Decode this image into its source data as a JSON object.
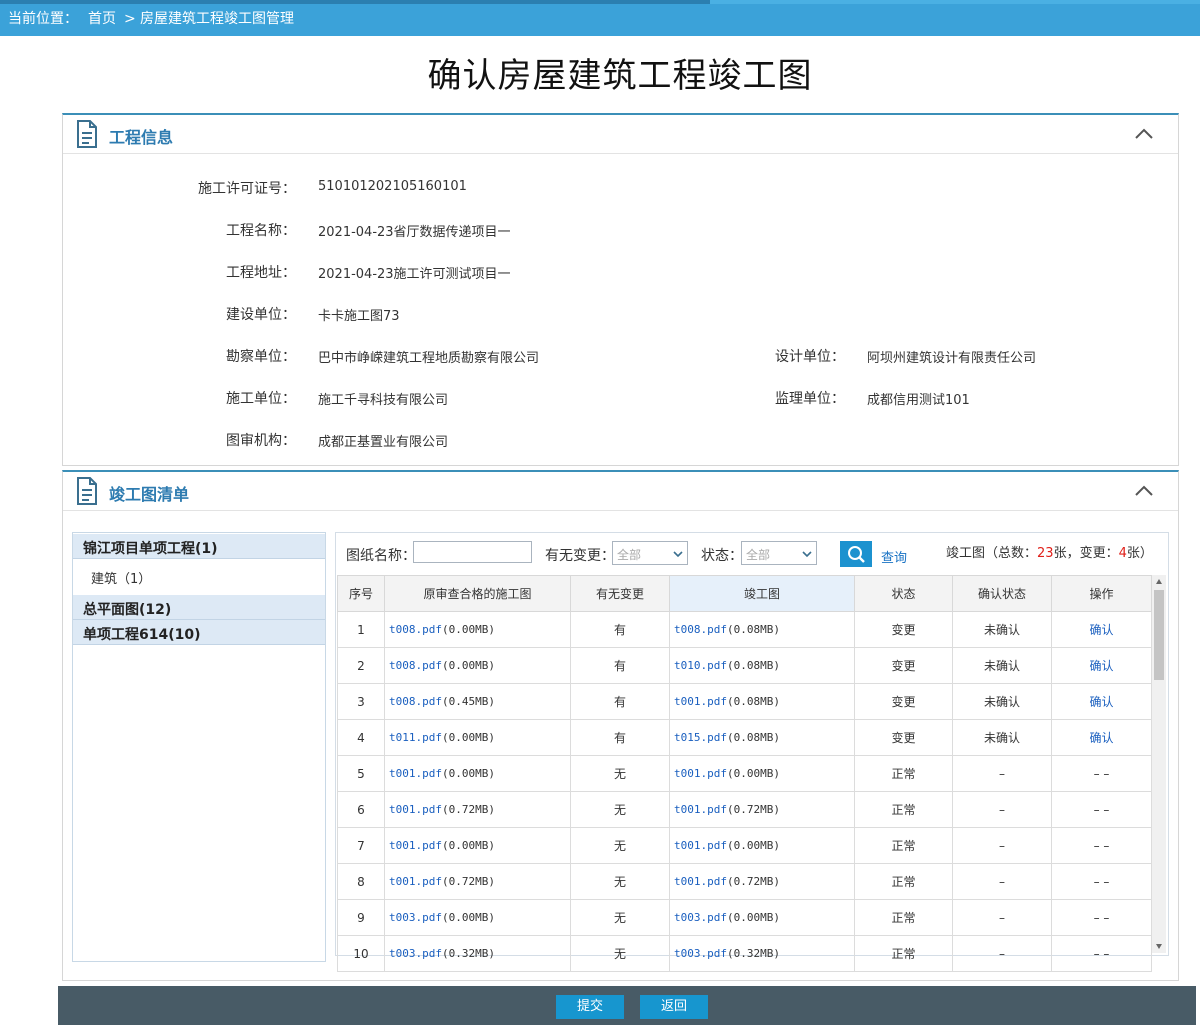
{
  "breadcrumb": {
    "label": "当前位置：",
    "home": "首页",
    "separator": ">",
    "current": "房屋建筑工程竣工图管理"
  },
  "page_title": "确认房屋建筑工程竣工图",
  "project_panel": {
    "title": "工程信息",
    "fields": {
      "permit_label": "施工许可证号：",
      "permit_value": "510101202105160101",
      "name_label": "工程名称：",
      "name_value": "2021-04-23省厅数据传递项目一",
      "address_label": "工程地址：",
      "address_value": "2021-04-23施工许可测试项目一",
      "builder_label": "建设单位：",
      "builder_value": "卡卡施工图73",
      "survey_label": "勘察单位：",
      "survey_value": "巴中市峥嵘建筑工程地质勘察有限公司",
      "design_label": "设计单位：",
      "design_value": "阿坝州建筑设计有限责任公司",
      "construction_label": "施工单位：",
      "construction_value": "施工千寻科技有限公司",
      "supervision_label": "监理单位：",
      "supervision_value": "成都信用测试101",
      "review_label": "图审机构：",
      "review_value": "成都正基置业有限公司"
    }
  },
  "drawings_panel": {
    "title": "竣工图清单",
    "tree": {
      "group1": "锦江项目单项工程(1)",
      "group1_child": "建筑（1）",
      "group2": "总平面图(12)",
      "group3": "单项工程614(10)"
    },
    "filters": {
      "name_label": "图纸名称：",
      "name_value": "",
      "change_label": "有无变更：",
      "change_value": "全部",
      "status_label": "状态：",
      "status_value": "全部",
      "search_label": "查询"
    },
    "stats": {
      "prefix": "竣工图（总数：",
      "total": "23",
      "mid": "张，变更：",
      "changed": "4",
      "suffix": "张）"
    },
    "table": {
      "headers": [
        "序号",
        "原审查合格的施工图",
        "有无变更",
        "竣工图",
        "状态",
        "确认状态",
        "操作"
      ],
      "rows": [
        {
          "no": "1",
          "orig": "t008.pdf",
          "orig_size": "(0.00MB)",
          "change": "有",
          "final": "t008.pdf",
          "final_size": "(0.08MB)",
          "status": "变更",
          "confirm": "未确认",
          "op": "确认"
        },
        {
          "no": "2",
          "orig": "t008.pdf",
          "orig_size": "(0.00MB)",
          "change": "有",
          "final": "t010.pdf",
          "final_size": "(0.08MB)",
          "status": "变更",
          "confirm": "未确认",
          "op": "确认"
        },
        {
          "no": "3",
          "orig": "t008.pdf",
          "orig_size": "(0.45MB)",
          "change": "有",
          "final": "t001.pdf",
          "final_size": "(0.08MB)",
          "status": "变更",
          "confirm": "未确认",
          "op": "确认"
        },
        {
          "no": "4",
          "orig": "t011.pdf",
          "orig_size": "(0.00MB)",
          "change": "有",
          "final": "t015.pdf",
          "final_size": "(0.08MB)",
          "status": "变更",
          "confirm": "未确认",
          "op": "确认"
        },
        {
          "no": "5",
          "orig": "t001.pdf",
          "orig_size": "(0.00MB)",
          "change": "无",
          "final": "t001.pdf",
          "final_size": "(0.00MB)",
          "status": "正常",
          "confirm": "–",
          "op": "– –"
        },
        {
          "no": "6",
          "orig": "t001.pdf",
          "orig_size": "(0.72MB)",
          "change": "无",
          "final": "t001.pdf",
          "final_size": "(0.72MB)",
          "status": "正常",
          "confirm": "–",
          "op": "– –"
        },
        {
          "no": "7",
          "orig": "t001.pdf",
          "orig_size": "(0.00MB)",
          "change": "无",
          "final": "t001.pdf",
          "final_size": "(0.00MB)",
          "status": "正常",
          "confirm": "–",
          "op": "– –"
        },
        {
          "no": "8",
          "orig": "t001.pdf",
          "orig_size": "(0.72MB)",
          "change": "无",
          "final": "t001.pdf",
          "final_size": "(0.72MB)",
          "status": "正常",
          "confirm": "–",
          "op": "– –"
        },
        {
          "no": "9",
          "orig": "t003.pdf",
          "orig_size": "(0.00MB)",
          "change": "无",
          "final": "t003.pdf",
          "final_size": "(0.00MB)",
          "status": "正常",
          "confirm": "–",
          "op": "– –"
        },
        {
          "no": "10",
          "orig": "t003.pdf",
          "orig_size": "(0.32MB)",
          "change": "无",
          "final": "t003.pdf",
          "final_size": "(0.32MB)",
          "status": "正常",
          "confirm": "–",
          "op": "– –"
        }
      ]
    }
  },
  "actions": {
    "submit": "提交",
    "back": "返回"
  },
  "colors": {
    "accent": "#3ba2d9",
    "title_blue": "#2d7bb0",
    "link": "#1a5fbf",
    "button": "#1796cf",
    "footer": "#485b66",
    "alert": "#e0201a"
  }
}
